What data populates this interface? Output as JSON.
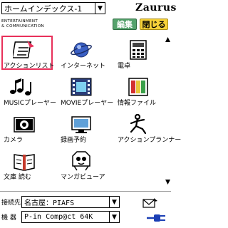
{
  "header": {
    "home_select": "ホームインデックス-1",
    "brand": "Zaurus",
    "sub_brand": "ENTERTAINMENT\n& COMMUNICATION",
    "edit_button": "編集",
    "close_button": "閉じる"
  },
  "apps": [
    {
      "label": "アクションリスト",
      "icon": "action-list-icon",
      "selected": true
    },
    {
      "label": "インターネット",
      "icon": "internet-icon"
    },
    {
      "label": "電卓",
      "icon": "calculator-icon"
    },
    {
      "label": "MUSICプレーヤー",
      "icon": "music-player-icon"
    },
    {
      "label": "MOVIEプレーヤー",
      "icon": "movie-player-icon"
    },
    {
      "label": "情報ファイル",
      "icon": "info-file-icon"
    },
    {
      "label": "カメラ",
      "icon": "camera-icon"
    },
    {
      "label": "録画予約",
      "icon": "recording-schedule-icon"
    },
    {
      "label": "アクションプランナー",
      "icon": "action-planner-icon"
    },
    {
      "label": "文庫 読む",
      "icon": "library-book-icon"
    },
    {
      "label": "マンガビューア",
      "icon": "manga-viewer-icon"
    }
  ],
  "footer": {
    "connection_label": "接続先",
    "connection_value": "名古屋：PIAFS",
    "device_label": "機 器",
    "device_value": "P-in Comp@ct 64K"
  },
  "colors": {
    "selection": "#e8305a",
    "edit_button": "#55a26c",
    "close_button": "#f7d23a"
  }
}
